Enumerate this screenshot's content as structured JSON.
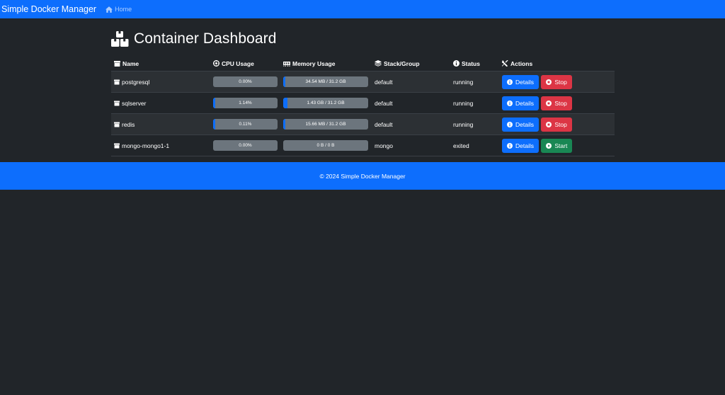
{
  "navbar": {
    "brand": "Simple Docker Manager",
    "home_label": "Home"
  },
  "page": {
    "title": "Container Dashboard"
  },
  "table": {
    "headers": {
      "name": "Name",
      "cpu": "CPU Usage",
      "memory": "Memory Usage",
      "stack": "Stack/Group",
      "status": "Status",
      "actions": "Actions"
    },
    "rows": [
      {
        "name": "postgresql",
        "cpu_text": "0.00%",
        "cpu_fraction": 0.0,
        "memory_text": "34.54 MB / 31.2 GB",
        "memory_fraction": 0.0011,
        "stack": "default",
        "status": "running",
        "details_label": "Details",
        "action_label": "Stop",
        "action_type": "stop"
      },
      {
        "name": "sqlserver",
        "cpu_text": "1.14%",
        "cpu_fraction": 0.0114,
        "memory_text": "1.43 GB / 31.2 GB",
        "memory_fraction": 0.046,
        "stack": "default",
        "status": "running",
        "details_label": "Details",
        "action_label": "Stop",
        "action_type": "stop"
      },
      {
        "name": "redis",
        "cpu_text": "0.11%",
        "cpu_fraction": 0.0011,
        "memory_text": "15.66 MB / 31.2 GB",
        "memory_fraction": 0.0005,
        "stack": "default",
        "status": "running",
        "details_label": "Details",
        "action_label": "Stop",
        "action_type": "stop"
      },
      {
        "name": "mongo-mongo1-1",
        "cpu_text": "0.00%",
        "cpu_fraction": 0.0,
        "memory_text": "0 B / 0 B",
        "memory_fraction": 0.0,
        "stack": "mongo",
        "status": "exited",
        "details_label": "Details",
        "action_label": "Start",
        "action_type": "start"
      }
    ]
  },
  "footer": {
    "text": "© 2024 Simple Docker Manager"
  },
  "colors": {
    "primary": "#0d6efd",
    "danger": "#dc3545",
    "success": "#198754",
    "background": "#212529",
    "progress_track": "#6c757d"
  }
}
